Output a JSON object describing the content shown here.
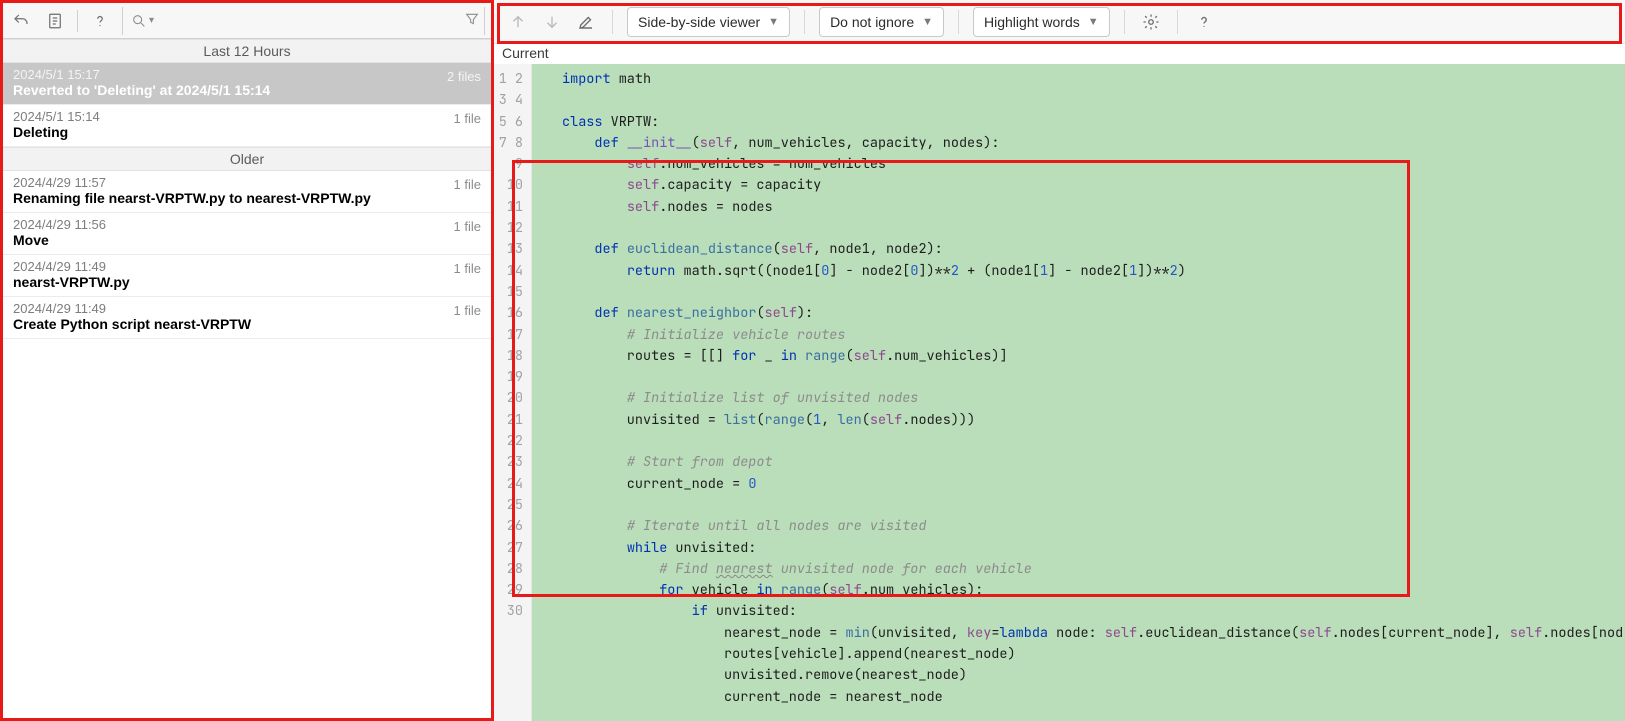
{
  "left": {
    "sections": [
      {
        "title": "Last 12 Hours",
        "entries": [
          {
            "ts": "2024/5/1 15:17",
            "label": "Reverted to 'Deleting' at 2024/5/1 15:14",
            "files": "2 files",
            "selected": true
          },
          {
            "ts": "2024/5/1 15:14",
            "label": "Deleting",
            "files": "1 file",
            "selected": false
          }
        ]
      },
      {
        "title": "Older",
        "entries": [
          {
            "ts": "2024/4/29 11:57",
            "label": "Renaming file nearst-VRPTW.py to nearest-VRPTW.py",
            "files": "1 file",
            "selected": false
          },
          {
            "ts": "2024/4/29 11:56",
            "label": "Move",
            "files": "1 file",
            "selected": false
          },
          {
            "ts": "2024/4/29 11:49",
            "label": "nearst-VRPTW.py",
            "files": "1 file",
            "selected": false
          },
          {
            "ts": "2024/4/29 11:49",
            "label": "Create Python script nearst-VRPTW",
            "files": "1 file",
            "selected": false
          }
        ]
      }
    ]
  },
  "right": {
    "tab": "Current",
    "viewer": "Side-by-side viewer",
    "ignore": "Do not ignore",
    "highlight": "Highlight words",
    "code_lines": [
      "<span class='kw'>import</span> math",
      "",
      "<span class='kw'>class</span> VRPTW:",
      "    <span class='kw'>def</span> <span class='def'>__init__</span>(<span class='self'>self</span>, num_vehicles, capacity, nodes):",
      "        <span class='self'>self</span>.num_vehicles = num_vehicles",
      "        <span class='self'>self</span>.capacity = capacity",
      "        <span class='self'>self</span>.nodes = nodes",
      "",
      "    <span class='kw'>def</span> <span class='fn'>euclidean_distance</span>(<span class='self'>self</span>, node1, node2):",
      "        <span class='kw'>return</span> math.sqrt((node1[<span class='num'>0</span>] - node2[<span class='num'>0</span>])**<span class='num'>2</span> + (node1[<span class='num'>1</span>] - node2[<span class='num'>1</span>])**<span class='num'>2</span>)",
      "",
      "    <span class='kw'>def</span> <span class='fn'>nearest_neighbor</span>(<span class='self'>self</span>):",
      "        <span class='cm'># Initialize vehicle routes</span>",
      "        routes = [[] <span class='kw'>for</span> _ <span class='kw'>in</span> <span class='fn'>range</span>(<span class='self'>self</span>.num_vehicles)]",
      "",
      "        <span class='cm'># Initialize list of unvisited nodes</span>",
      "        unvisited = <span class='fn'>list</span>(<span class='fn'>range</span>(<span class='num'>1</span>, <span class='fn'>len</span>(<span class='self'>self</span>.nodes)))",
      "",
      "        <span class='cm'># Start from depot</span>",
      "        current_node = <span class='num'>0</span>",
      "",
      "        <span class='cm'># Iterate until all nodes are visited</span>",
      "        <span class='kw'>while</span> unvisited:",
      "            <span class='cm'># Find <span class='strike'>nearest</span> unvisited node for each vehicle</span>",
      "            <span class='kw'>for</span> vehicle <span class='kw'>in</span> <span class='fn'>range</span>(<span class='self'>self</span>.num_vehicles):",
      "                <span class='kw'>if</span> unvisited:",
      "                    nearest_node = <span class='fn'>min</span>(unvisited, <span class='self'>key</span>=<span class='kw'>lambda</span> node: <span class='self'>self</span>.euclidean_distance(<span class='self'>self</span>.nodes[current_node], <span class='self'>self</span>.nodes[nod",
      "                    routes[vehicle].append(nearest_node)",
      "                    unvisited.remove(nearest_node)",
      "                    current_node = nearest_node"
    ]
  }
}
